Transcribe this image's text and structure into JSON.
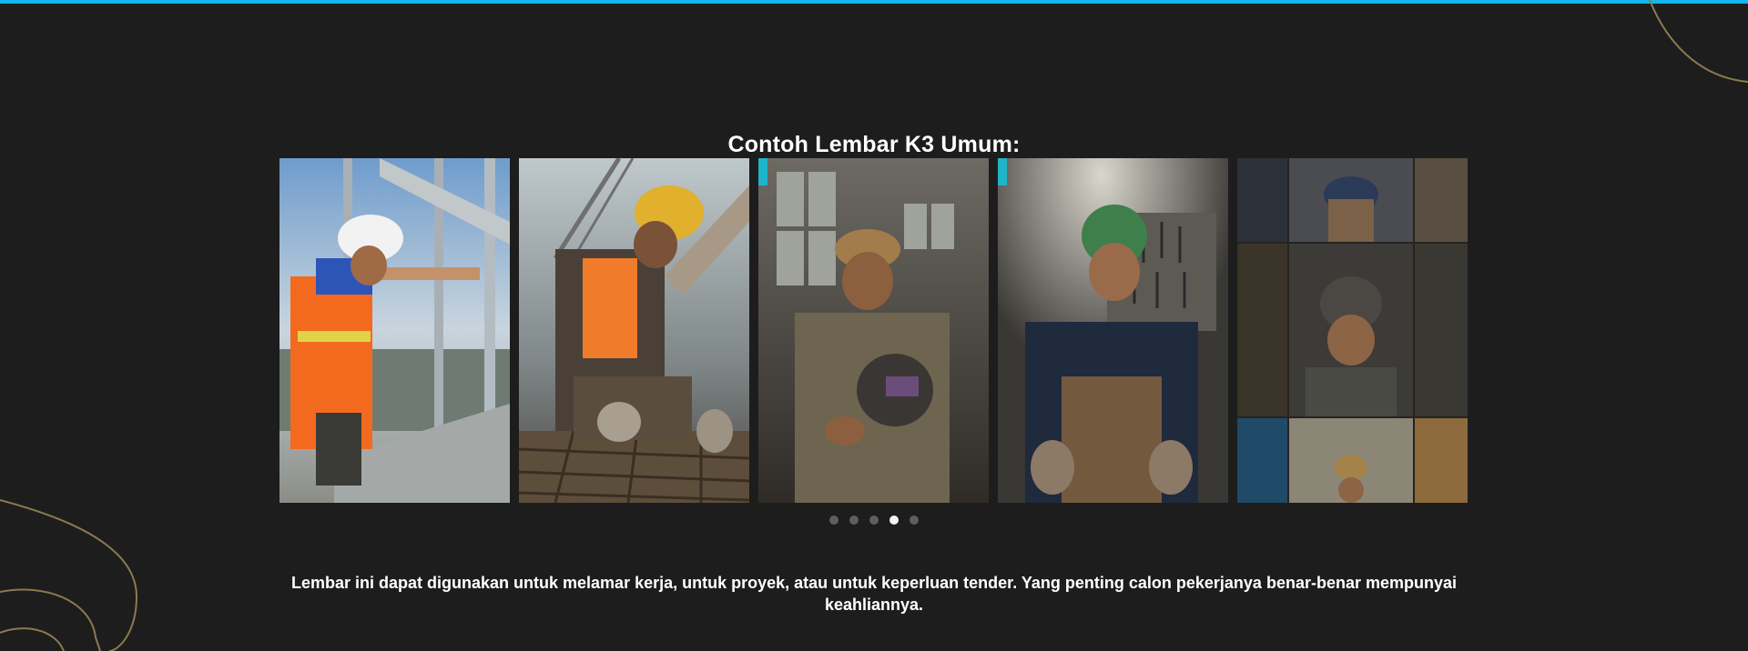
{
  "colors": {
    "background": "#1d1d1d",
    "accent_top_bar": "#12b8ec",
    "decor_line": "#8a7a4e",
    "dot_inactive": "#5e5e5e",
    "dot_active": "#f4f4f4"
  },
  "section": {
    "title": "Contoh Lembar K3 Umum:",
    "caption": "Lembar ini dapat digunakan untuk melamar kerja, untuk proyek, atau untuk keperluan tender. Yang penting calon pekerjanya benar-benar mempunyai keahliannya."
  },
  "carousel": {
    "slides": [
      {
        "subject": "worker in white helmet and orange safety vest on high-rise steel frame"
      },
      {
        "subject": "worker in yellow helmet tying rebar with crane in background"
      },
      {
        "subject": "smiling welder holding welding mask in workshop"
      },
      {
        "subject": "smiling welder with green welding helmet in front of tool wall"
      },
      {
        "subject": "collage of workers in workshop"
      }
    ],
    "dots": [
      "1",
      "2",
      "3",
      "4",
      "5"
    ],
    "active_dot": 4
  },
  "icons": {
    "tile_badge": "video-badge-icon"
  }
}
